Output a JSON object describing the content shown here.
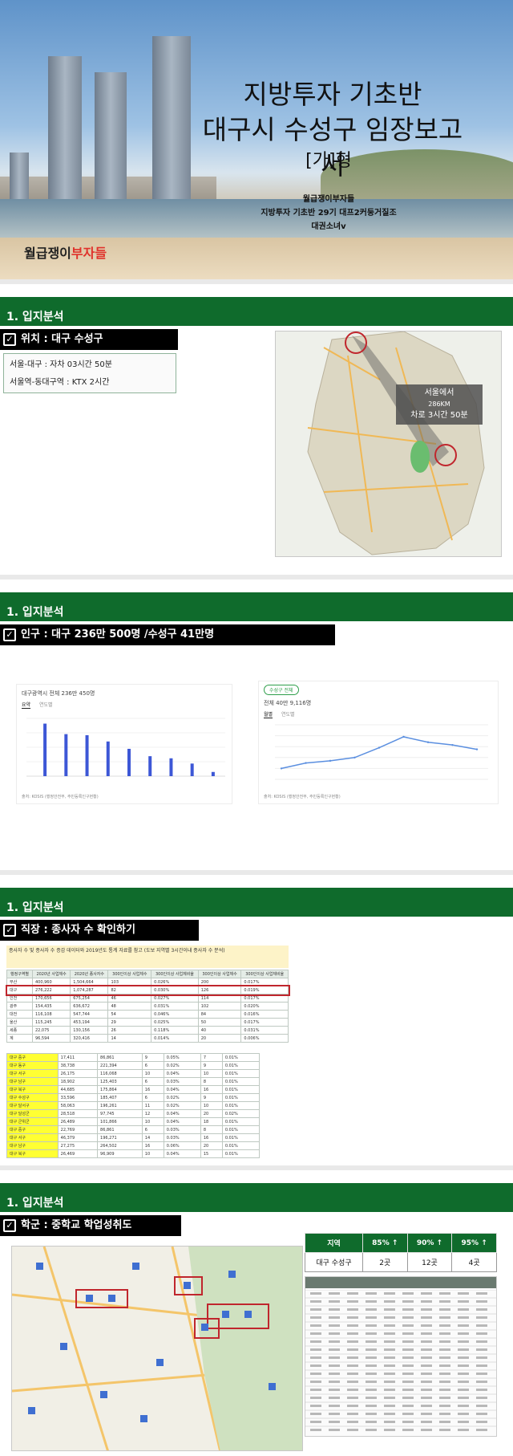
{
  "cover": {
    "title_line1": "지방투자 기초반",
    "title_line2": "대구시 수성구 임장보고서",
    "type": "[가]형",
    "sub1": "월급쟁이부자들",
    "sub2": "지방투자 기초반 29기 대프2커둥거질조",
    "sub3": "대권소녀v",
    "brand_a": "월급쟁이",
    "brand_b": "부자들"
  },
  "sections": [
    {
      "header": "1. 입지분석",
      "label": "위치 : 대구 수성구"
    },
    {
      "header": "1. 입지분석",
      "label": "인구 : 대구 236만 500명 /수성구 41만명"
    },
    {
      "header": "1. 입지분석",
      "label": "직장 : 종사자 수 확인하기"
    },
    {
      "header": "1. 입지분석",
      "label": "학군 : 중학교 학업성취도"
    }
  ],
  "location": {
    "line1": "서울-대구 : 자차 03시간 50분",
    "line2": "서울역-동대구역 : KTX 2시간",
    "tip1": "서울에서",
    "tip2": "286KM",
    "tip3": "차로 3시간 50분"
  },
  "population": {
    "left_title": "대구광역시 전체 236만 450명",
    "left_tabs": [
      "요약",
      "연도별"
    ],
    "left_source": "출처: KOSIS (행정안전부, 주민등록인구현황)",
    "right_badge": "수성구 전체",
    "right_title": "전체 40만 9,116명",
    "right_tabs": [
      "월별",
      "연도별"
    ],
    "right_source": "출처: KOSIS (행정안전부, 주민등록인구현황)"
  },
  "chart_data": [
    {
      "type": "bar",
      "categories": [
        "",
        "",
        "",
        "",
        "",
        "",
        "",
        "",
        ""
      ],
      "values": [
        100,
        80,
        78,
        66,
        52,
        38,
        34,
        24,
        8
      ],
      "title": "대구광역시 전체 236만 450명",
      "xlabel": "",
      "ylabel": "",
      "ylim": [
        0,
        110
      ]
    },
    {
      "type": "line",
      "x": [
        "",
        "",
        "",
        "",
        "",
        "",
        "",
        "",
        ""
      ],
      "series": [
        {
          "values": [
            20,
            30,
            34,
            40,
            58,
            78,
            68,
            63,
            55
          ]
        }
      ],
      "title": "전체 40만 9,116명",
      "xlabel": "",
      "ylabel": "",
      "ylim": [
        0,
        100
      ]
    }
  ],
  "work": {
    "note": "종사자 수 및 종사자 수 증감 데이터와 2019년도 통계 자료를 참고 (도보 지역별 3시간이내 종사자 수 분석)",
    "table1": {
      "head": [
        "행정구역별",
        "2020년 사업체수",
        "2020년 종사자수",
        "300인이상 사업체수",
        "300인이상 사업체비율",
        "300인이상 사업체수",
        "300인이상 사업체비율"
      ],
      "rows": [
        [
          "부산",
          "400,960",
          "1,504,664",
          "103",
          "0.026%",
          "200",
          "0.017%"
        ],
        [
          "대구",
          "276,222",
          "1,074,287",
          "82",
          "0.030%",
          "126",
          "0.019%"
        ],
        [
          "인천",
          "170,656",
          "675,254",
          "46",
          "0.027%",
          "114",
          "0.017%"
        ],
        [
          "광주",
          "154,435",
          "636,672",
          "48",
          "0.031%",
          "102",
          "0.020%"
        ],
        [
          "대전",
          "116,108",
          "547,744",
          "54",
          "0.046%",
          "84",
          "0.016%"
        ],
        [
          "울산",
          "115,245",
          "453,194",
          "29",
          "0.025%",
          "50",
          "0.017%"
        ],
        [
          "세종",
          "22,075",
          "130,156",
          "26",
          "0.118%",
          "40",
          "0.031%"
        ],
        [
          "계",
          "96,594",
          "320,416",
          "14",
          "0.014%",
          "20",
          "0.006%"
        ]
      ]
    },
    "table2": {
      "rows": [
        [
          "대구 중구",
          "17,411",
          "86,861",
          "9",
          "0.05%",
          "7",
          "0.01%"
        ],
        [
          "대구 동구",
          "38,738",
          "221,394",
          "6",
          "0.02%",
          "9",
          "0.01%"
        ],
        [
          "대구 서구",
          "26,175",
          "116,068",
          "10",
          "0.04%",
          "10",
          "0.01%"
        ],
        [
          "대구 남구",
          "18,902",
          "125,403",
          "6",
          "0.03%",
          "8",
          "0.01%"
        ],
        [
          "대구 북구",
          "44,685",
          "175,864",
          "16",
          "0.04%",
          "16",
          "0.01%"
        ],
        [
          "대구 수성구",
          "33,596",
          "185,407",
          "6",
          "0.02%",
          "9",
          "0.01%"
        ],
        [
          "대구 달서구",
          "58,063",
          "196,261",
          "11",
          "0.02%",
          "10",
          "0.01%"
        ],
        [
          "대구 달성군",
          "28,518",
          "97,745",
          "12",
          "0.04%",
          "20",
          "0.02%"
        ],
        [
          "대구 군위군",
          "26,489",
          "101,866",
          "10",
          "0.04%",
          "18",
          "0.01%"
        ],
        [
          "대구 중구",
          "22,769",
          "86,861",
          "6",
          "0.03%",
          "8",
          "0.01%"
        ],
        [
          "대구 서구",
          "46,379",
          "196,271",
          "14",
          "0.03%",
          "16",
          "0.01%"
        ],
        [
          "대구 남구",
          "27,275",
          "264,502",
          "16",
          "0.06%",
          "20",
          "0.01%"
        ],
        [
          "대구 북구",
          "26,469",
          "96,909",
          "10",
          "0.04%",
          "15",
          "0.01%"
        ]
      ]
    }
  },
  "school": {
    "head": [
      "지역",
      "85% ↑",
      "90% ↑",
      "95% ↑"
    ],
    "row": [
      "대구 수성구",
      "2곳",
      "12곳",
      "4곳"
    ]
  },
  "colors": {
    "accent": "#0f6b2c",
    "highlight": "#e0322b",
    "marker": "#ffff33"
  }
}
